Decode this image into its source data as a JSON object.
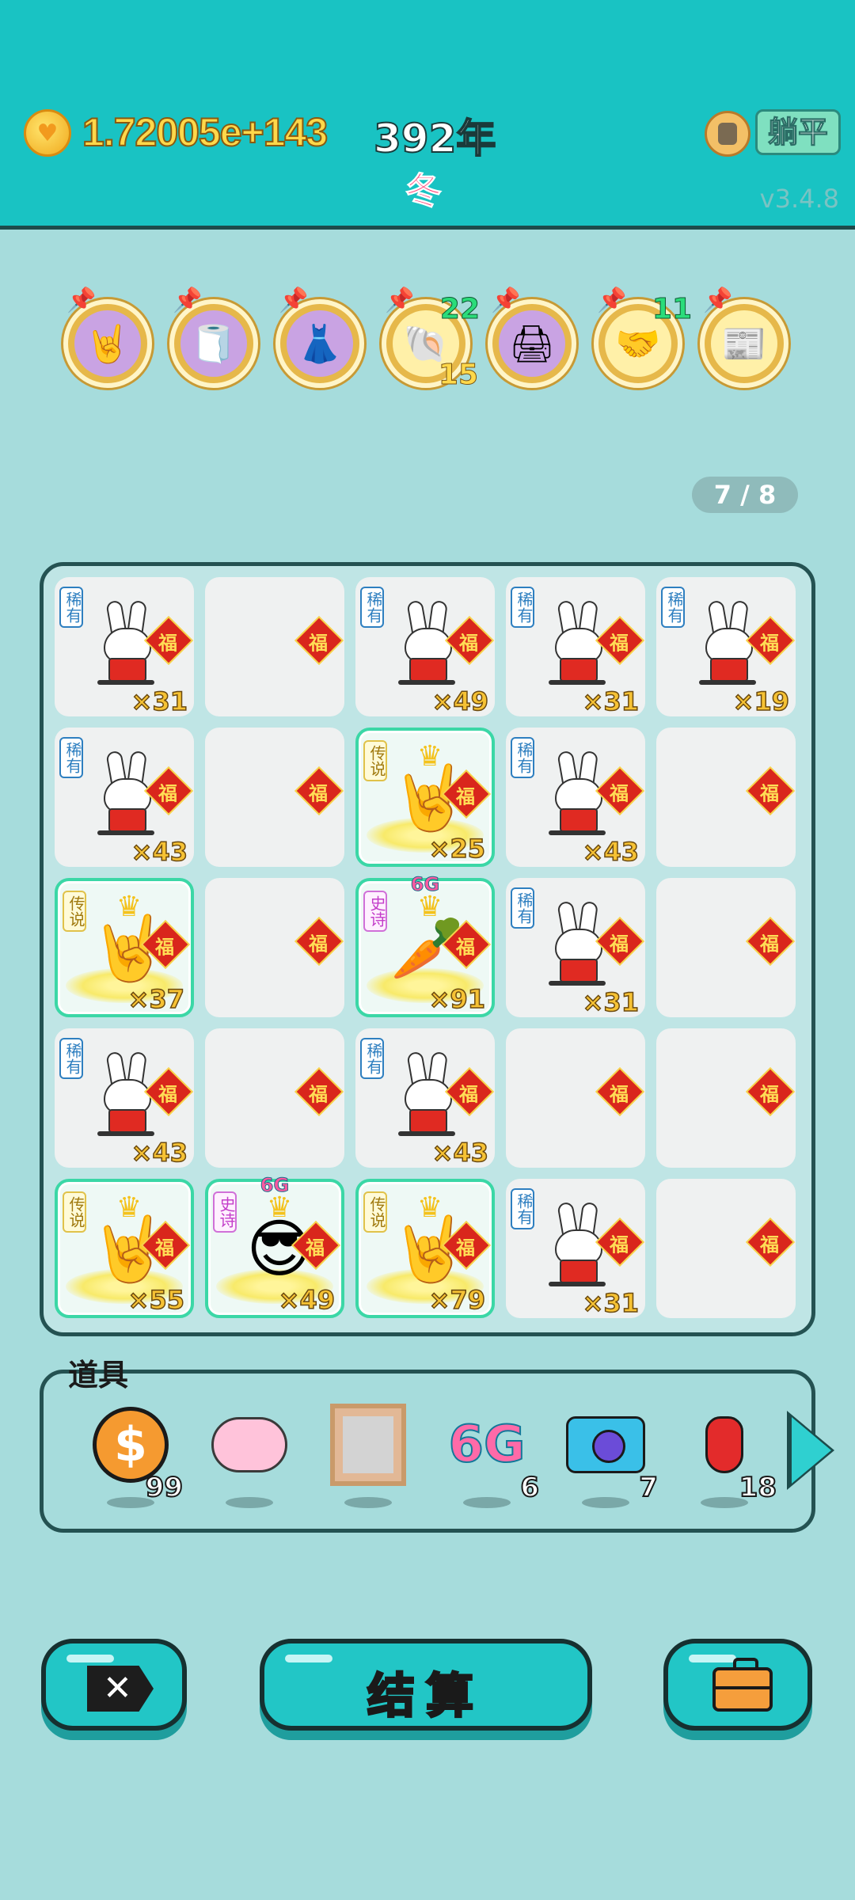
{
  "header": {
    "coins": "1.72005e+143",
    "year": "392年",
    "season": "冬",
    "lie_flat": "躺平",
    "version": "v3.4.8"
  },
  "relics": [
    {
      "icon": "rock-hand-icon",
      "glyph": "🤘",
      "count_top": "",
      "count_bottom": ""
    },
    {
      "icon": "tissue-box-icon",
      "glyph": "🧻",
      "count_top": "",
      "count_bottom": ""
    },
    {
      "icon": "skirt-icon",
      "glyph": "👗",
      "count_top": "",
      "count_bottom": ""
    },
    {
      "icon": "shell-icon",
      "glyph": "🐚",
      "count_top": "22",
      "count_bottom": "15"
    },
    {
      "icon": "printer-icon",
      "glyph": "🖨",
      "count_top": "",
      "count_bottom": ""
    },
    {
      "icon": "handshake-icon",
      "glyph": "🤝",
      "count_top": "11",
      "count_bottom": ""
    },
    {
      "icon": "time-magazine-icon",
      "glyph": "📰",
      "count_top": "",
      "count_bottom": ""
    }
  ],
  "page_indicator": "7 / 8",
  "board": {
    "cells": [
      {
        "type": "rabbit",
        "tag": "稀有",
        "mult": "×31"
      },
      {
        "type": "empty",
        "tag": "",
        "mult": ""
      },
      {
        "type": "rabbit",
        "tag": "稀有",
        "mult": "×49"
      },
      {
        "type": "rabbit",
        "tag": "稀有",
        "mult": "×31"
      },
      {
        "type": "rabbit",
        "tag": "稀有",
        "mult": "×19"
      },
      {
        "type": "rabbit",
        "tag": "稀有",
        "mult": "×43"
      },
      {
        "type": "empty",
        "tag": "",
        "mult": ""
      },
      {
        "type": "hand",
        "tag": "传说",
        "mult": "×25"
      },
      {
        "type": "rabbit",
        "tag": "稀有",
        "mult": "×43"
      },
      {
        "type": "empty",
        "tag": "",
        "mult": ""
      },
      {
        "type": "hand",
        "tag": "传说",
        "mult": "×37"
      },
      {
        "type": "empty",
        "tag": "",
        "mult": ""
      },
      {
        "type": "carrot",
        "tag": "史诗",
        "mult": "×91"
      },
      {
        "type": "rabbit",
        "tag": "稀有",
        "mult": "×31"
      },
      {
        "type": "empty",
        "tag": "",
        "mult": ""
      },
      {
        "type": "rabbit",
        "tag": "稀有",
        "mult": "×43"
      },
      {
        "type": "empty",
        "tag": "",
        "mult": ""
      },
      {
        "type": "rabbit",
        "tag": "稀有",
        "mult": "×43"
      },
      {
        "type": "empty",
        "tag": "",
        "mult": ""
      },
      {
        "type": "empty",
        "tag": "",
        "mult": ""
      },
      {
        "type": "hand",
        "tag": "传说",
        "mult": "×55"
      },
      {
        "type": "guy",
        "tag": "史诗",
        "mult": "×49"
      },
      {
        "type": "hand",
        "tag": "传说",
        "mult": "×79"
      },
      {
        "type": "rabbit",
        "tag": "稀有",
        "mult": "×31"
      },
      {
        "type": "empty",
        "tag": "",
        "mult": ""
      }
    ],
    "fu_char": "福",
    "sixg_badge": "6G"
  },
  "tray": {
    "title": "道具",
    "items": [
      {
        "name": "coin-item",
        "label": "$",
        "qty": "99"
      },
      {
        "name": "piggy-bank-item",
        "label": "",
        "qty": ""
      },
      {
        "name": "portrait-frame-item",
        "label": "",
        "qty": ""
      },
      {
        "name": "sixg-item",
        "label": "6G",
        "qty": "6"
      },
      {
        "name": "camera-item",
        "label": "",
        "qty": "7"
      },
      {
        "name": "chili-pepper-item",
        "label": "",
        "qty": "18"
      }
    ]
  },
  "buttons": {
    "close_icon": "✕",
    "settle_label": "结算"
  }
}
